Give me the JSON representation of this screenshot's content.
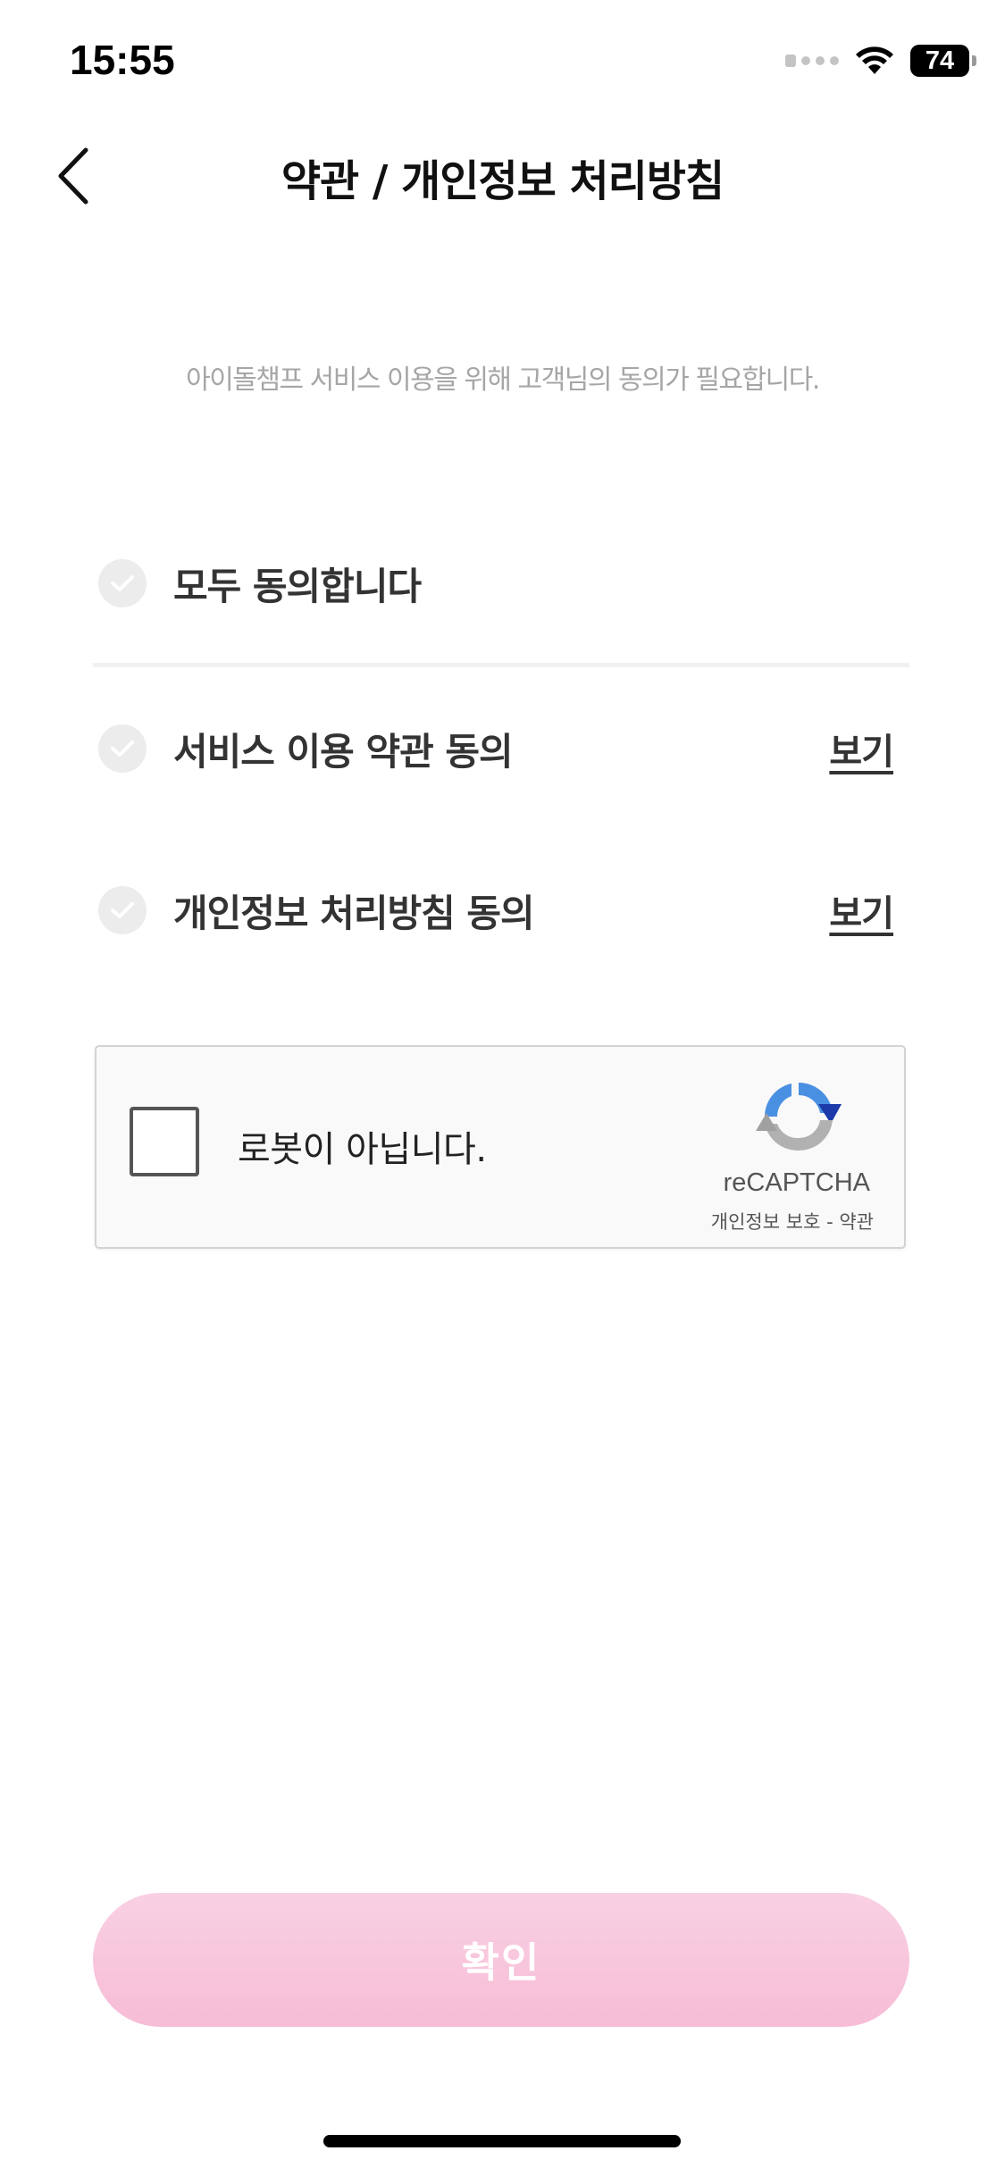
{
  "status_bar": {
    "time": "15:55",
    "battery": "74",
    "signal_icon": "cellular-signal-icon",
    "wifi_icon": "wifi-icon",
    "battery_icon": "battery-icon"
  },
  "header": {
    "title": "약관 / 개인정보 처리방침",
    "back_icon": "chevron-left-icon"
  },
  "subtitle": "아이돌챔프 서비스 이용을 위해 고객님의 동의가 필요합니다.",
  "agreements": {
    "all": {
      "label": "모두 동의합니다",
      "checked": false
    },
    "items": [
      {
        "label": "서비스 이용 약관 동의",
        "link": "보기",
        "checked": false
      },
      {
        "label": "개인정보 처리방침 동의",
        "link": "보기",
        "checked": false
      }
    ]
  },
  "recaptcha": {
    "label": "로봇이 아닙니다.",
    "brand": "reCAPTCHA",
    "privacy": "개인정보 보호",
    "separator": "-",
    "terms": "약관",
    "checked": false
  },
  "confirm": {
    "label": "확인",
    "enabled": false
  },
  "colors": {
    "confirm_gradient_top": "#f9d0e3",
    "confirm_gradient_bottom": "#f7bdd6",
    "check_circle": "#ececec",
    "subtitle": "#a6a6a6"
  }
}
